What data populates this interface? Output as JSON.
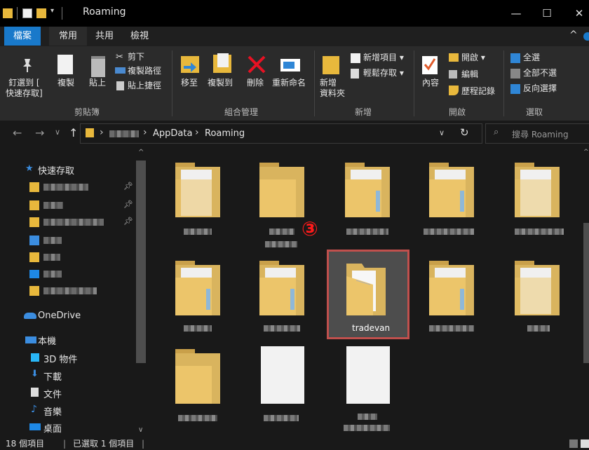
{
  "window": {
    "title": "Roaming",
    "minimize": "—",
    "maximize": "☐",
    "close": "✕"
  },
  "menu": {
    "file": "檔案",
    "home": "常用",
    "share": "共用",
    "view": "檢視",
    "collapse": "^"
  },
  "ribbon": {
    "clipboard": {
      "pin": "釘選到 [\n快速存取]",
      "copy": "複製",
      "paste": "貼上",
      "cut": "剪下",
      "copy_path": "複製路徑",
      "paste_shortcut": "貼上捷徑",
      "title": "剪貼簿"
    },
    "organize": {
      "move_to": "移至",
      "copy_to": "複製到",
      "delete": "刪除",
      "rename": "重新命名",
      "title": "組合管理"
    },
    "new": {
      "new_folder": "新增\n資料夾",
      "new_item": "新增項目 ▾",
      "easy_access": "輕鬆存取 ▾",
      "title": "新增"
    },
    "open": {
      "properties": "內容",
      "open": "開啟 ▾",
      "edit": "編輯",
      "history": "歷程記錄",
      "title": "開啟"
    },
    "select": {
      "select_all": "全選",
      "select_none": "全部不選",
      "invert": "反向選擇",
      "title": "選取"
    }
  },
  "address": {
    "seg1": "AppData",
    "seg2": "Roaming",
    "sep": "›",
    "search_placeholder": "搜尋 Roaming"
  },
  "nav": {
    "quick_access": "快速存取",
    "onedrive": "OneDrive",
    "this_pc": "本機",
    "items": [
      "3D 物件",
      "下載",
      "文件",
      "音樂",
      "桌面"
    ]
  },
  "content": {
    "selected_folder": "tradevan",
    "badge": "③"
  },
  "status": {
    "count": "18 個項目",
    "selected": "已選取 1 個項目"
  },
  "colors": {
    "accent": "#1979ca",
    "selection_border": "#c0504d",
    "badge": "#ff1a1a"
  }
}
